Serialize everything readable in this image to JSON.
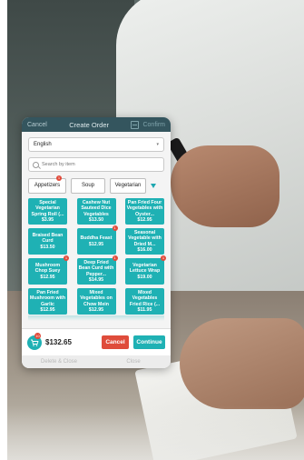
{
  "titlebar": {
    "cancel_label": "Cancel",
    "title": "Create Order",
    "confirm_label": "Confirm"
  },
  "language_select": {
    "value": "English"
  },
  "search": {
    "placeholder": "Search by item"
  },
  "categories": [
    {
      "label": "Appetizers",
      "badge": "1"
    },
    {
      "label": "Soup",
      "badge": null
    },
    {
      "label": "Vegetarian",
      "badge": null
    }
  ],
  "menu_items": [
    {
      "name": "Special Vegetarian Spring Roll (...",
      "price": "$3.95",
      "badge": null
    },
    {
      "name": "Cashew Nut Sauteed Dice Vegetables",
      "price": "$13.50",
      "badge": null
    },
    {
      "name": "Pan Fried Four Vegetables with Oyster...",
      "price": "$12.95",
      "badge": null
    },
    {
      "name": "Braised Bean Curd",
      "price": "$13.50",
      "badge": null
    },
    {
      "name": "Buddha Feast",
      "price": "$12.95",
      "badge": "1"
    },
    {
      "name": "Seasonal Vegetable with Dried M...",
      "price": "$16.00",
      "badge": null
    },
    {
      "name": "Mushroom Chop Suey",
      "price": "$12.95",
      "badge": "1"
    },
    {
      "name": "Deep Fried Bean Curd with Pepper...",
      "price": "$14.95",
      "badge": "1"
    },
    {
      "name": "Vegetarian Lettuce Wrap",
      "price": "$19.00",
      "badge": "1"
    },
    {
      "name": "Pan Fried Mushroom with Garlic",
      "price": "$12.95",
      "badge": null
    },
    {
      "name": "Mixed Vegetables on Chow Mein",
      "price": "$12.95",
      "badge": null
    },
    {
      "name": "Mixed Vegetables Fried Rice (...",
      "price": "$11.95",
      "badge": null
    }
  ],
  "cart": {
    "count": "10",
    "total": "$132.65"
  },
  "footer": {
    "cancel_label": "Cancel",
    "continue_label": "Continue"
  },
  "behind_bar": {
    "left_label": "Delete & Close",
    "right_label": "Close"
  },
  "colors": {
    "teal": "#1fb1b4",
    "header": "#34555e",
    "danger": "#df4c3b",
    "badge": "#e14a3a"
  }
}
